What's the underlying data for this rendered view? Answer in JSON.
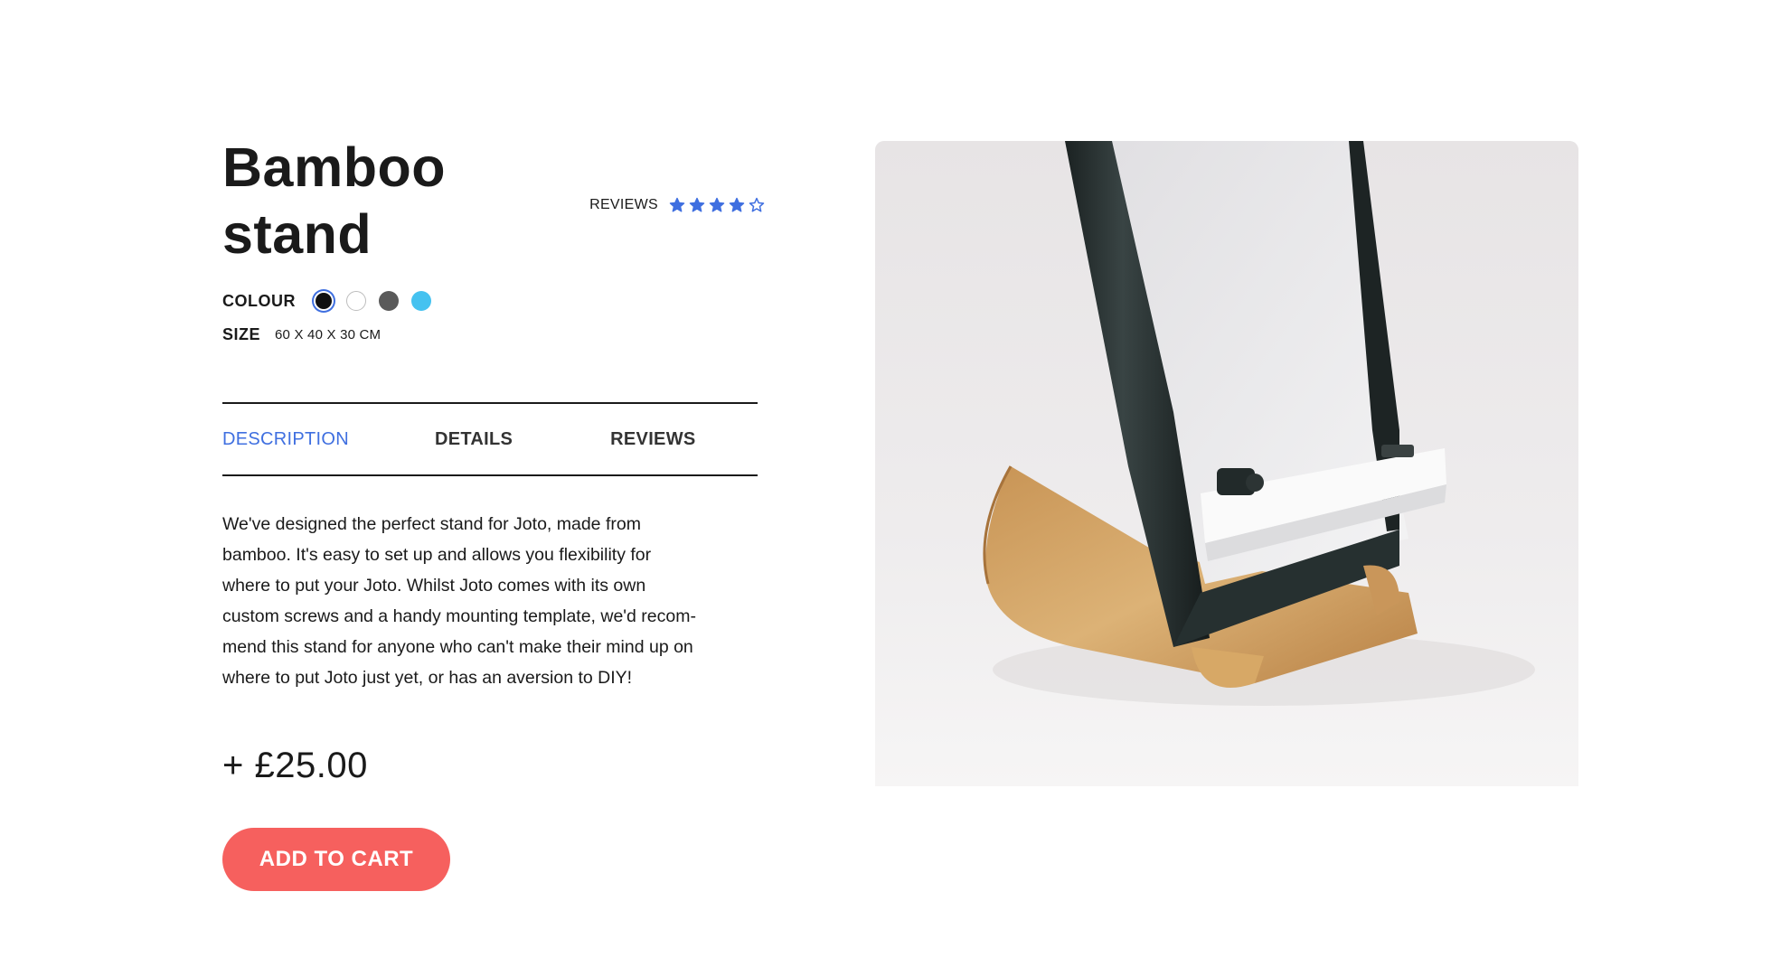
{
  "product": {
    "title": "Bamboo stand",
    "reviews_label": "REVIEWS",
    "rating": {
      "value": 4,
      "max": 5,
      "star_color": "#3f6fe0"
    },
    "colour_label": "COLOUR",
    "colours": [
      {
        "name": "black",
        "hex": "#111111",
        "selected": true
      },
      {
        "name": "white",
        "hex": "#ffffff",
        "selected": false
      },
      {
        "name": "grey",
        "hex": "#5a5a5a",
        "selected": false
      },
      {
        "name": "light-blue",
        "hex": "#45c2f0",
        "selected": false
      }
    ],
    "size_label": "SIZE",
    "size_value": "60 X 40 X 30 CM",
    "price": "+ £25.00"
  },
  "tabs": {
    "description": "DESCRIPTION",
    "details": "DETAILS",
    "reviews": "REVIEWS",
    "active": "description"
  },
  "description": {
    "lines": [
      "We've designed the perfect stand for Joto, made from",
      "bamboo. It's easy to set up and allows you flexibility for",
      "where to put your Joto. Whilst Joto comes with its own",
      "custom screws and a handy mounting template, we'd recom-",
      "mend this stand for anyone who can't make their mind up on",
      "where to put Joto just yet, or has an aversion to DIY!"
    ]
  },
  "actions": {
    "add_to_cart": "ADD TO CART"
  },
  "colors": {
    "accent": "#3f6fe0",
    "cta": "#f6605e",
    "text": "#1a1a1a"
  }
}
